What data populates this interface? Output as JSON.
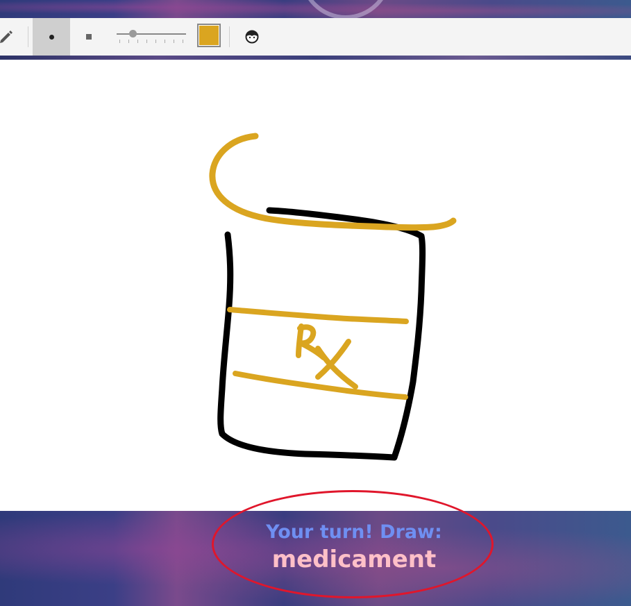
{
  "toolbar": {
    "tools": [
      {
        "name": "pencil-tool",
        "icon": "pencil-icon"
      },
      {
        "name": "round-brush",
        "icon": "round-dot-icon",
        "selected": true
      },
      {
        "name": "square-brush",
        "icon": "square-dot-icon"
      }
    ],
    "brush_size_fraction": 0.2,
    "current_color": "#DAA520",
    "extra_icon": "smiley-face-icon"
  },
  "canvas": {
    "background": "#ffffff",
    "drawing_colors": [
      "#000000",
      "#DAA520"
    ]
  },
  "prompt": {
    "line1": "Your turn! Draw:",
    "word": "medicament",
    "highlight_color": "#e0162b"
  }
}
